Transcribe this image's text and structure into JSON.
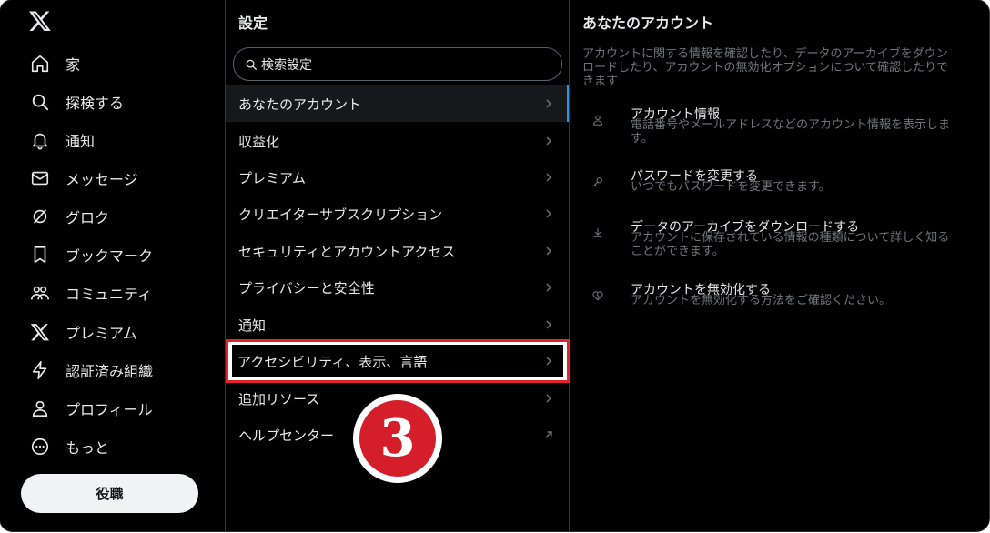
{
  "nav": {
    "items": [
      {
        "label": "家",
        "icon": "home-icon"
      },
      {
        "label": "探検する",
        "icon": "search-icon"
      },
      {
        "label": "通知",
        "icon": "bell-icon"
      },
      {
        "label": "メッセージ",
        "icon": "mail-icon"
      },
      {
        "label": "グロク",
        "icon": "grok-icon"
      },
      {
        "label": "ブックマーク",
        "icon": "bookmark-icon"
      },
      {
        "label": "コミュニティ",
        "icon": "communities-icon"
      },
      {
        "label": "プレミアム",
        "icon": "x-logo-icon"
      },
      {
        "label": "認証済み組織",
        "icon": "lightning-icon"
      },
      {
        "label": "プロフィール",
        "icon": "person-icon"
      },
      {
        "label": "もっと",
        "icon": "more-circle-icon"
      }
    ],
    "post_label": "役職"
  },
  "settings": {
    "title": "設定",
    "search_placeholder": "検索設定",
    "items": [
      {
        "label": "あなたのアカウント"
      },
      {
        "label": "収益化"
      },
      {
        "label": "プレミアム"
      },
      {
        "label": "クリエイターサブスクリプション"
      },
      {
        "label": "セキュリティとアカウントアクセス"
      },
      {
        "label": "プライバシーと安全性"
      },
      {
        "label": "通知"
      },
      {
        "label": "アクセシビリティ、表示、言語"
      },
      {
        "label": "追加リソース"
      },
      {
        "label": "ヘルプセンター"
      }
    ]
  },
  "annotation": {
    "step_number": "3",
    "color": "#d41f2a"
  },
  "detail": {
    "title": "あなたのアカウント",
    "description": "アカウントに関する情報を確認したり、データのアーカイブをダウン\nロードしたり、アカウントの無効化オプションについて確認したりで\nきます",
    "items": [
      {
        "title": "アカウント情報",
        "subtitle": "電話番号やメールアドレスなどのアカウント情報を表示しま\nす。",
        "icon": "person-outline-icon"
      },
      {
        "title": "パスワードを変更する",
        "subtitle": "いつでもパスワードを変更できます。",
        "icon": "key-icon"
      },
      {
        "title": "データのアーカイブをダウンロードする",
        "subtitle": "アカウントに保存されている情報の種類について詳しく知る\nことができます。",
        "icon": "download-icon"
      },
      {
        "title": "アカウントを無効化する",
        "subtitle": "アカウントを無効化する方法をご確認ください。",
        "icon": "broken-heart-icon"
      }
    ]
  },
  "colors": {
    "accent": "#1d9bf0",
    "highlight": "#e0242a",
    "background": "#000000"
  }
}
